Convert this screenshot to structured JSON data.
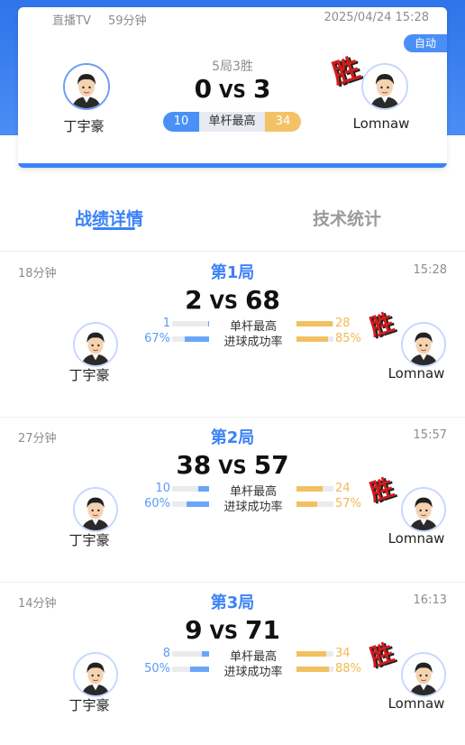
{
  "header": {
    "channel": "直播TV",
    "duration": "59分钟",
    "datetime": "2025/04/24 15:28",
    "auto_label": "自动",
    "format": "5局3胜",
    "score_left": "0",
    "vs": "VS",
    "score_right": "3",
    "player_left": "丁宇豪",
    "player_right": "Lomnaw",
    "win_mark": "胜",
    "best_break_label": "单杆最高",
    "best_break_left": "10",
    "best_break_right": "34"
  },
  "tabs": [
    {
      "label": "战绩详情",
      "active": true
    },
    {
      "label": "技术统计",
      "active": false
    }
  ],
  "colors": {
    "accent": "#3b82f6",
    "left_player": "#4a90f6",
    "right_player": "#f3c266",
    "win": "#d21c1c"
  },
  "games": [
    {
      "duration": "18分钟",
      "title": "第1局",
      "time": "15:28",
      "score_left": "2",
      "vs": "VS",
      "score_right": "68",
      "player_left": "丁宇豪",
      "player_right": "Lomnaw",
      "win_mark": "胜",
      "stats": [
        {
          "label": "单杆最高",
          "left": "1",
          "right": "28",
          "left_frac": 0.03,
          "right_frac": 0.97
        },
        {
          "label": "进球成功率",
          "left": "67%",
          "right": "85%",
          "left_frac": 0.67,
          "right_frac": 0.85
        }
      ]
    },
    {
      "duration": "27分钟",
      "title": "第2局",
      "time": "15:57",
      "score_left": "38",
      "vs": "VS",
      "score_right": "57",
      "player_left": "丁宇豪",
      "player_right": "Lomnaw",
      "win_mark": "胜",
      "stats": [
        {
          "label": "单杆最高",
          "left": "10",
          "right": "24",
          "left_frac": 0.29,
          "right_frac": 0.71
        },
        {
          "label": "进球成功率",
          "left": "60%",
          "right": "57%",
          "left_frac": 0.6,
          "right_frac": 0.57
        }
      ]
    },
    {
      "duration": "14分钟",
      "title": "第3局",
      "time": "16:13",
      "score_left": "9",
      "vs": "VS",
      "score_right": "71",
      "player_left": "丁宇豪",
      "player_right": "Lomnaw",
      "win_mark": "胜",
      "stats": [
        {
          "label": "单杆最高",
          "left": "8",
          "right": "34",
          "left_frac": 0.19,
          "right_frac": 0.81
        },
        {
          "label": "进球成功率",
          "left": "50%",
          "right": "88%",
          "left_frac": 0.5,
          "right_frac": 0.88
        }
      ]
    }
  ]
}
